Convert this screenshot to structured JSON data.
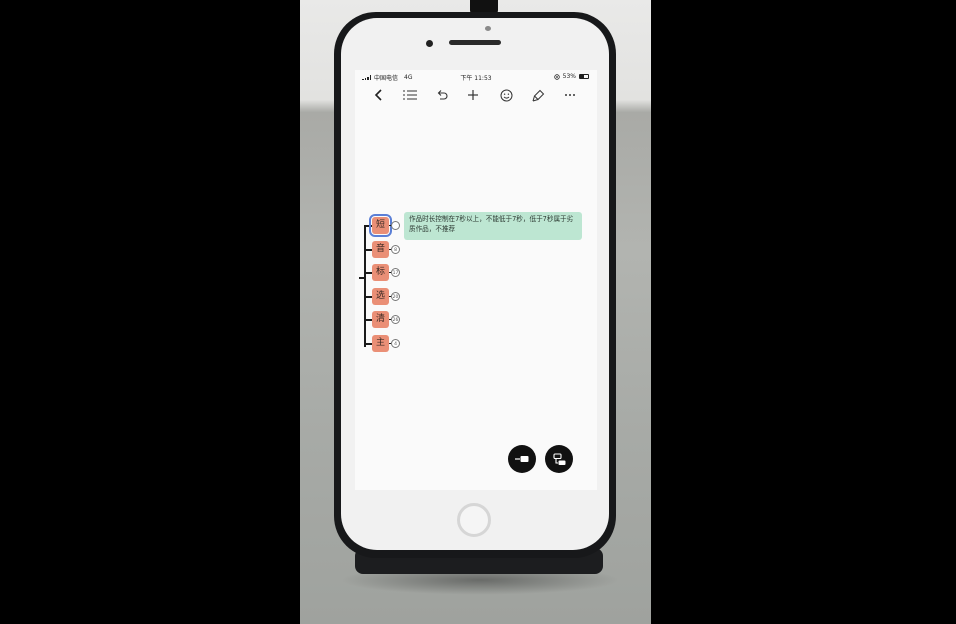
{
  "status_bar": {
    "carrier": "中国电信",
    "network": "4G",
    "time": "下午 11:53",
    "battery": "53%",
    "battery_level": 0.53
  },
  "toolbar": {
    "icons": [
      "back-icon",
      "outline-list-icon",
      "undo-icon",
      "add-icon",
      "emoji-icon",
      "highlighter-icon",
      "more-icon"
    ]
  },
  "mindmap": {
    "nodes": [
      {
        "label": "短",
        "badge": "",
        "selected": true
      },
      {
        "label": "音",
        "badge": "8"
      },
      {
        "label": "标",
        "badge": "17"
      },
      {
        "label": "选",
        "badge": "20"
      },
      {
        "label": "清",
        "badge": "26"
      },
      {
        "label": "主",
        "badge": "4"
      }
    ],
    "note": "作品时长控制在7秒以上，不能低于7秒，低于7秒属于劣质作品，不推荐"
  },
  "colors": {
    "node": "#ea8f76",
    "note": "#bde6d2",
    "selection": "#5b7fd6"
  }
}
